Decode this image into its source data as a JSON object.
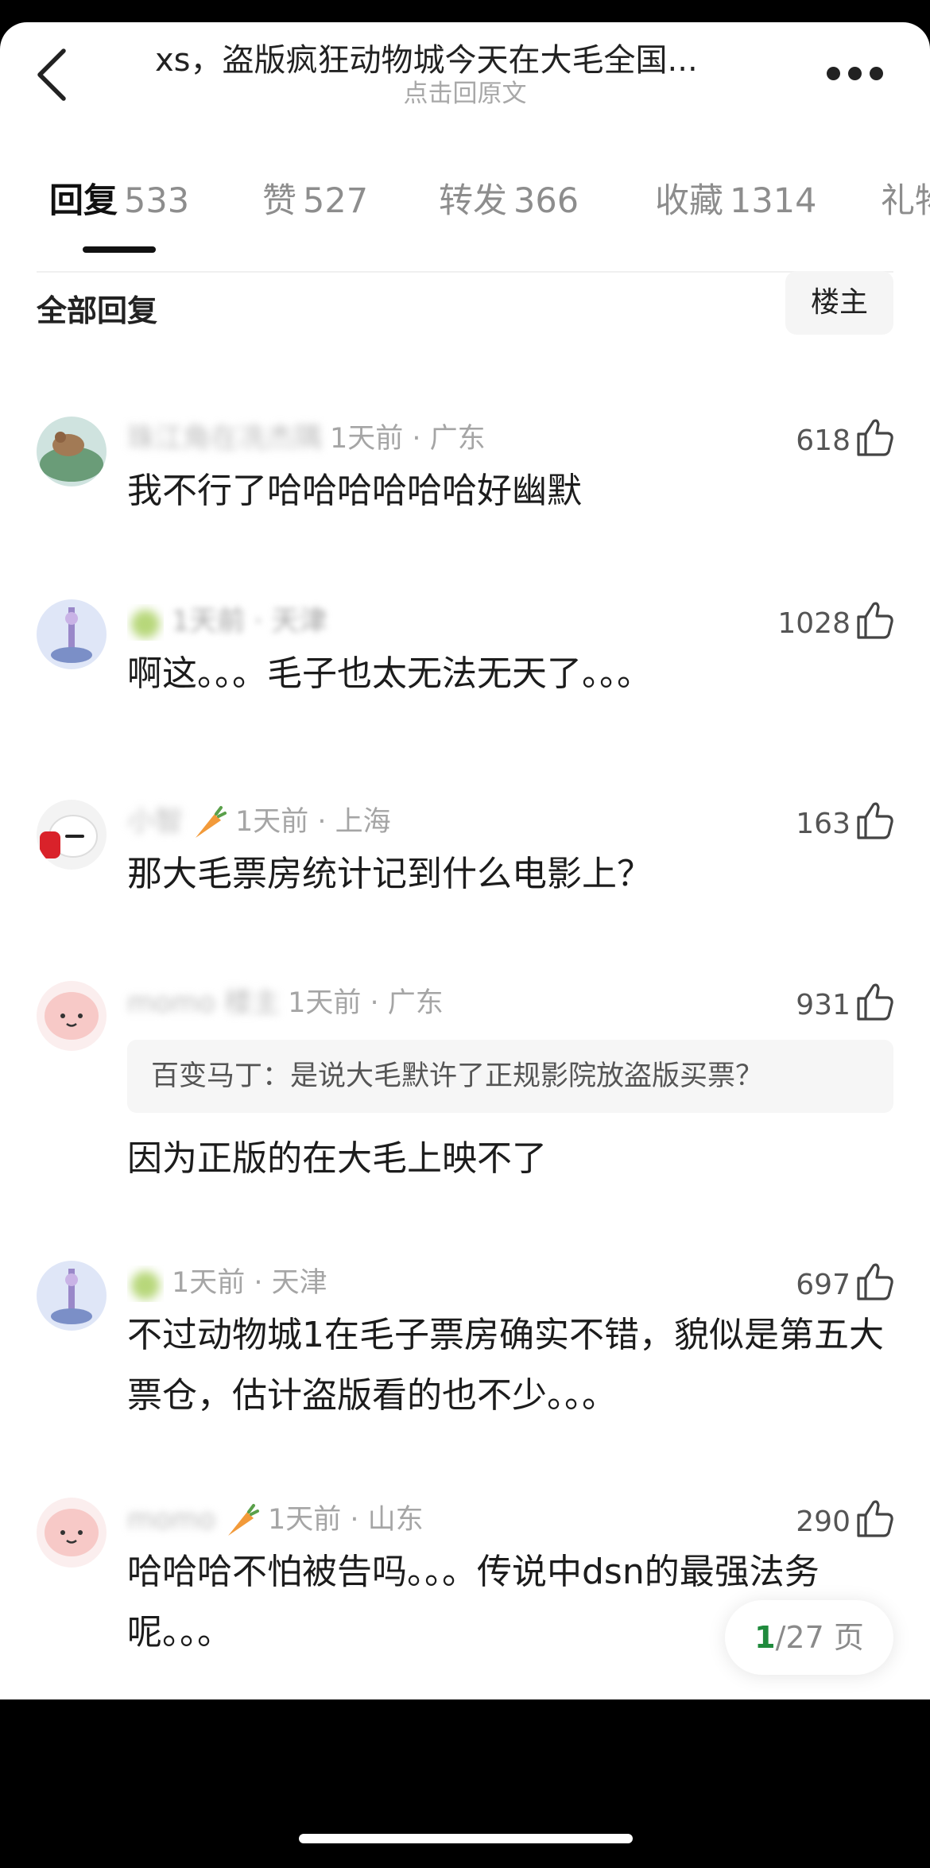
{
  "header": {
    "title": "xs，盗版疯狂动物城今天在大毛全国...",
    "subtitle": "点击回原文",
    "back_icon": "chevron-left-icon",
    "more_icon": "more-dots-icon"
  },
  "tabs": [
    {
      "label": "回复",
      "count": "533",
      "active": true
    },
    {
      "label": "赞",
      "count": "527",
      "active": false
    },
    {
      "label": "转发",
      "count": "366",
      "active": false
    },
    {
      "label": "收藏",
      "count": "1314",
      "active": false
    },
    {
      "label": "礼物",
      "count": "",
      "active": false
    }
  ],
  "section": {
    "title": "全部回复",
    "owner_filter": "楼主"
  },
  "colors": {
    "accent_green": "#1f8a3c",
    "text_primary": "#1c1c1c",
    "text_secondary": "#a5a5a5"
  },
  "comments": [
    {
      "nickname": "珠江角在冼杰隅",
      "time_location": "1天前 · 广东",
      "likes": "618",
      "text": "我不行了哈哈哈哈哈哈好幽默"
    },
    {
      "nickname": "",
      "time_location": "1天前 · 天津",
      "likes": "1028",
      "text": "啊这。。。毛子也太无法无天了。。。"
    },
    {
      "nickname": "小智",
      "time_location": "1天前 · 上海",
      "likes": "163",
      "text": "那大毛票房统计记到什么电影上？"
    },
    {
      "nickname": "momo 楼主",
      "time_location": "1天前 · 广东",
      "likes": "931",
      "quote": "百变马丁：是说大毛默许了正规影院放盗版买票？",
      "text": "因为正版的在大毛上映不了"
    },
    {
      "nickname": "",
      "time_location": "1天前 · 天津",
      "likes": "697",
      "text": "不过动物城1在毛子票房确实不错，貌似是第五大票仓，估计盗版看的也不少。。。"
    },
    {
      "nickname": "momo",
      "time_location": "1天前 · 山东",
      "likes": "290",
      "text": "哈哈哈不怕被告吗。。。传说中dsn的最强法务呢。。。"
    }
  ],
  "pager": {
    "current": "1",
    "total": "/27 页"
  }
}
